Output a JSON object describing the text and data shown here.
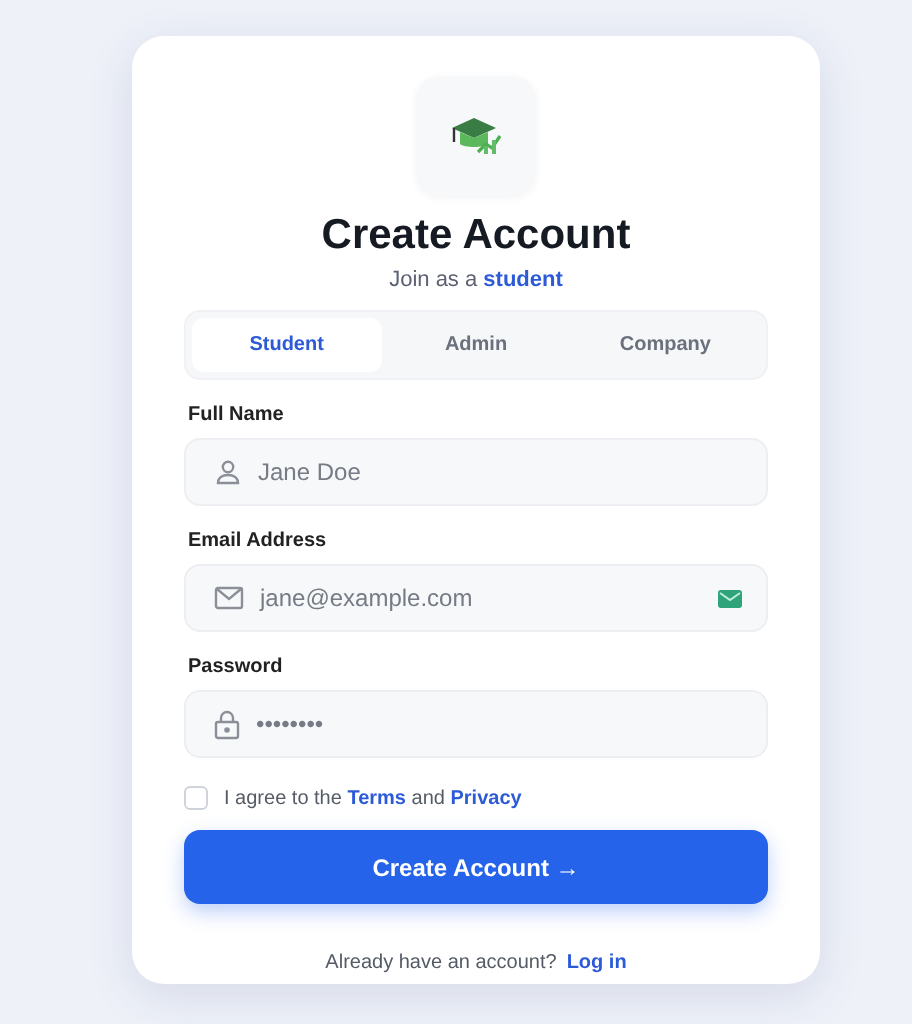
{
  "title": "Create Account",
  "subtitle": "Join as a **student**",
  "tabs": [
    {
      "label": "Student",
      "selected": true
    },
    {
      "label": "Admin",
      "selected": false
    },
    {
      "label": "Company",
      "selected": false
    }
  ],
  "fields": [
    {
      "kind": "name",
      "label": "Full Name",
      "placeholder": "Jane Doe"
    },
    {
      "kind": "email",
      "label": "Email Address",
      "placeholder": "jane@example.com",
      "verified": true
    },
    {
      "kind": "password",
      "label": "Password",
      "placeholder": "••••••••"
    }
  ],
  "agree": {
    "checked": false,
    "before": "I agree to the",
    "terms": "Terms",
    "middle": "and",
    "privacy": "Privacy"
  },
  "submit": {
    "label": "Create Account",
    "arrow": "→"
  },
  "login": {
    "prompt": "Already have an account?",
    "link": "Log in"
  }
}
